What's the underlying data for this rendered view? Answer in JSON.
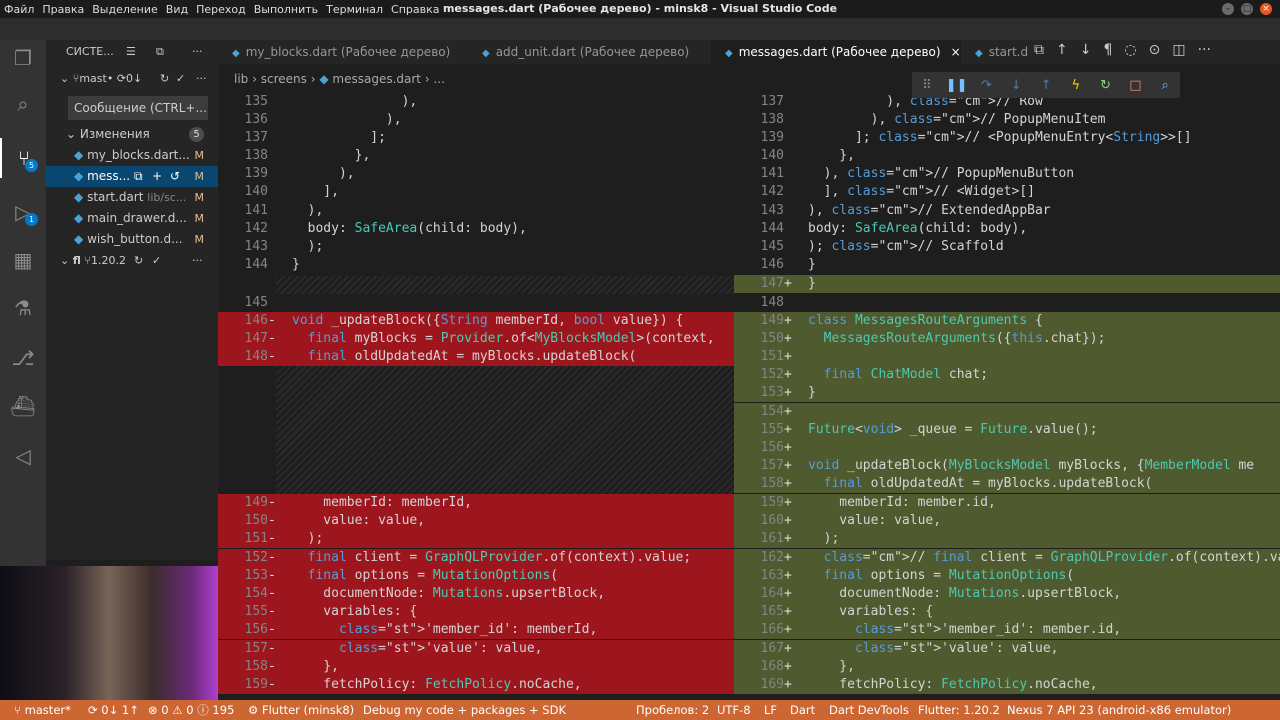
{
  "window": {
    "title": "messages.dart (Рабочее дерево) - minsk8 - Visual Studio Code",
    "menu": [
      "Файл",
      "Правка",
      "Выделение",
      "Вид",
      "Переход",
      "Выполнить",
      "Терминал",
      "Справка"
    ]
  },
  "sidebar": {
    "header": "СИСТЕ...",
    "branch": "mast•",
    "branch_sync": "0↓",
    "commit_placeholder": "Сообщение (CTRL+...",
    "changes_label": "Изменения",
    "changes_count": "5",
    "files": [
      {
        "name": "my_blocks.dart...",
        "status": "M"
      },
      {
        "name": "mess...",
        "status": "M"
      },
      {
        "name": "start.dart",
        "path": "lib/sc...",
        "status": "M"
      },
      {
        "name": "main_drawer.d...",
        "status": "M"
      },
      {
        "name": "wish_button.d...",
        "status": "M"
      }
    ],
    "repo2": "fl",
    "repo2_branch": "1.20.2"
  },
  "activity": {
    "scm_badge": "5",
    "debug_badge": "1"
  },
  "tabs": [
    {
      "label": "my_blocks.dart (Рабочее дерево)"
    },
    {
      "label": "add_unit.dart (Рабочее дерево)"
    },
    {
      "label": "messages.dart (Рабочее дерево)"
    },
    {
      "label": "start.d"
    }
  ],
  "breadcrumb": [
    "lib",
    "screens",
    "messages.dart",
    "..."
  ],
  "status": {
    "branch": "master*",
    "sync": "0↓ 1↑",
    "errors": "0",
    "warnings": "0",
    "info": "195",
    "flutter": "Flutter (minsk8)",
    "debug": "Debug my code + packages + SDK",
    "spaces": "Пробелов: 2",
    "encoding": "UTF-8",
    "eol": "LF",
    "lang": "Dart",
    "devtools": "Dart DevTools",
    "flutter_ver": "Flutter: 1.20.2",
    "device": "Nexus 7 API 23 (android-x86 emulator)"
  },
  "left_lines": [
    {
      "n": "135",
      "t": "              ),"
    },
    {
      "n": "136",
      "t": "            ),"
    },
    {
      "n": "137",
      "t": "          ];"
    },
    {
      "n": "138",
      "t": "        },"
    },
    {
      "n": "139",
      "t": "      ),"
    },
    {
      "n": "140",
      "t": "    ],"
    },
    {
      "n": "141",
      "t": "  ),"
    },
    {
      "n": "142",
      "t": "  body: SafeArea(child: body),"
    },
    {
      "n": "143",
      "t": "  );"
    },
    {
      "n": "144",
      "t": "}"
    },
    {
      "n": "145",
      "t": ""
    },
    {
      "n": "146",
      "g": "-",
      "t": "void _updateBlock({String memberId, bool value}) {"
    },
    {
      "n": "147",
      "g": "-",
      "t": "  final myBlocks = Provider.of<MyBlocksModel>(context,"
    },
    {
      "n": "148",
      "g": "-",
      "t": "  final oldUpdatedAt = myBlocks.updateBlock("
    },
    {
      "n": "149",
      "g": "-",
      "t": "    memberId: memberId,"
    },
    {
      "n": "150",
      "g": "-",
      "t": "    value: value,"
    },
    {
      "n": "151",
      "g": "-",
      "t": "  );"
    },
    {
      "n": "152",
      "g": "-",
      "t": "  final client = GraphQLProvider.of(context).value;"
    },
    {
      "n": "153",
      "g": "-",
      "t": "  final options = MutationOptions("
    },
    {
      "n": "154",
      "g": "-",
      "t": "    documentNode: Mutations.upsertBlock,"
    },
    {
      "n": "155",
      "g": "-",
      "t": "    variables: {"
    },
    {
      "n": "156",
      "g": "-",
      "t": "      'member_id': memberId,"
    },
    {
      "n": "157",
      "g": "-",
      "t": "      'value': value,"
    },
    {
      "n": "158",
      "g": "-",
      "t": "    },"
    },
    {
      "n": "159",
      "g": "-",
      "t": "    fetchPolicy: FetchPolicy.noCache,"
    }
  ],
  "right_lines": [
    {
      "n": "137",
      "t": "          ), // Row"
    },
    {
      "n": "138",
      "t": "        ), // PopupMenuItem"
    },
    {
      "n": "139",
      "t": "      ]; // <PopupMenuEntry<String>>[]"
    },
    {
      "n": "140",
      "t": "    },"
    },
    {
      "n": "141",
      "t": "  ), // PopupMenuButton"
    },
    {
      "n": "142",
      "t": "  ], // <Widget>[]"
    },
    {
      "n": "143",
      "t": "), // ExtendedAppBar"
    },
    {
      "n": "144",
      "t": "body: SafeArea(child: body),"
    },
    {
      "n": "145",
      "t": "); // Scaffold"
    },
    {
      "n": "146",
      "t": "}"
    },
    {
      "n": "147",
      "g": "+",
      "t": "}"
    },
    {
      "n": "148",
      "t": ""
    },
    {
      "n": "149",
      "g": "+",
      "t": "class MessagesRouteArguments {"
    },
    {
      "n": "150",
      "g": "+",
      "t": "  MessagesRouteArguments({this.chat});"
    },
    {
      "n": "151",
      "g": "+",
      "t": ""
    },
    {
      "n": "152",
      "g": "+",
      "t": "  final ChatModel chat;"
    },
    {
      "n": "153",
      "g": "+",
      "t": "}"
    },
    {
      "n": "154",
      "g": "+",
      "t": ""
    },
    {
      "n": "155",
      "g": "+",
      "t": "Future<void> _queue = Future.value();"
    },
    {
      "n": "156",
      "g": "+",
      "t": ""
    },
    {
      "n": "157",
      "g": "+",
      "t": "void _updateBlock(MyBlocksModel myBlocks, {MemberModel me"
    },
    {
      "n": "158",
      "g": "+",
      "t": "  final oldUpdatedAt = myBlocks.updateBlock("
    },
    {
      "n": "159",
      "g": "+",
      "t": "    memberId: member.id,"
    },
    {
      "n": "160",
      "g": "+",
      "t": "    value: value,"
    },
    {
      "n": "161",
      "g": "+",
      "t": "  );"
    },
    {
      "n": "162",
      "g": "+",
      "t": "  // final client = GraphQLProvider.of(context).value;"
    },
    {
      "n": "163",
      "g": "+",
      "t": "  final options = MutationOptions("
    },
    {
      "n": "164",
      "g": "+",
      "t": "    documentNode: Mutations.upsertBlock,"
    },
    {
      "n": "165",
      "g": "+",
      "t": "    variables: {"
    },
    {
      "n": "166",
      "g": "+",
      "t": "      'member_id': member.id,"
    },
    {
      "n": "167",
      "g": "+",
      "t": "      'value': value,"
    },
    {
      "n": "168",
      "g": "+",
      "t": "    },"
    },
    {
      "n": "169",
      "g": "+",
      "t": "    fetchPolicy: FetchPolicy.noCache,"
    }
  ]
}
